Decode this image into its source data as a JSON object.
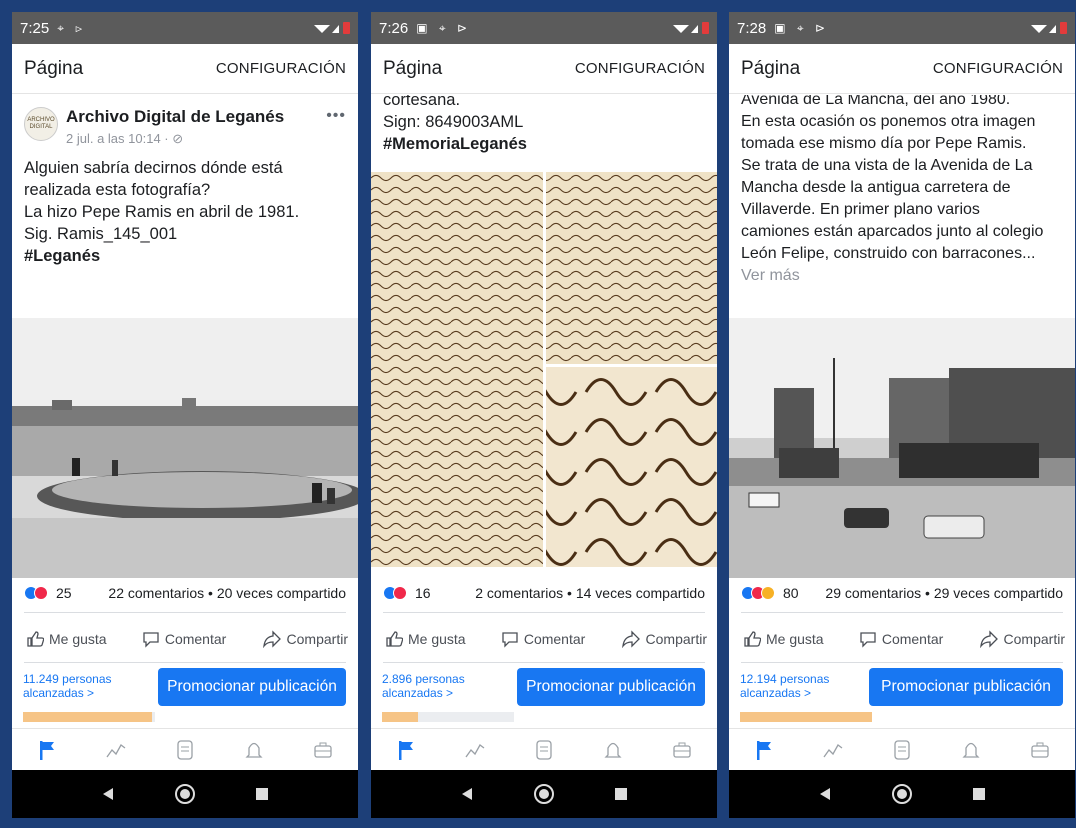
{
  "screens": [
    {
      "time": "7:25",
      "status_icons": "⌖ ⊳",
      "header": {
        "title": "Página",
        "config": "CONFIGURACIÓN"
      },
      "post": {
        "page_name": "Archivo Digital de Leganés",
        "meta": "2 jul. a las 10:14 · ",
        "avatar_text": "ARCHIVO DIGITAL",
        "lines": [
          "Alguien sabría decirnos dónde está",
          "realizada esta fotografía?",
          "La hizo Pepe Ramis en abril de 1981.",
          "Sig. Ramis_145_001"
        ],
        "hashtag": "#Leganés"
      },
      "reactions_count": "25",
      "comments_shares": "22 comentarios • 20 veces compartido",
      "actions": {
        "like": "Me gusta",
        "comment": "Comentar",
        "share": "Compartir"
      },
      "reach_line1": "11.249 personas",
      "reach_line2": "alcanzadas >",
      "reach_progress": 0.98,
      "promote": "Promocionar publicación"
    },
    {
      "time": "7:26",
      "status_icons": "▣ ⌖ ⊳",
      "header": {
        "title": "Página",
        "config": "CONFIGURACIÓN"
      },
      "post": {
        "lines": [
          "cortesana.",
          "Sign: 8649003AML"
        ],
        "hashtag": "#MemoriaLeganés"
      },
      "reactions_count": "16",
      "comments_shares": "2 comentarios • 14 veces compartido",
      "actions": {
        "like": "Me gusta",
        "comment": "Comentar",
        "share": "Compartir"
      },
      "reach_line1": "2.896 personas",
      "reach_line2": "alcanzadas >",
      "reach_progress": 0.27,
      "promote": "Promocionar publicación"
    },
    {
      "time": "7:28",
      "status_icons": "▣ ⌖ ⊳",
      "header": {
        "title": "Página",
        "config": "CONFIGURACIÓN"
      },
      "post": {
        "lines": [
          "Avenida de La Mancha, del año 1980.",
          "En esta ocasión os ponemos otra imagen",
          "tomada ese mismo día por Pepe Ramis.",
          "Se trata de una vista de la Avenida de La",
          "Mancha desde la antigua carretera de",
          "Villaverde. En primer plano  varios",
          "camiones están aparcados junto al colegio",
          "León Felipe, construido con barracones..."
        ],
        "see_more": "Ver más"
      },
      "reactions_count": "80",
      "comments_shares": "29 comentarios • 29 veces compartido",
      "actions": {
        "like": "Me gusta",
        "comment": "Comentar",
        "share": "Compartir"
      },
      "reach_line1": "12.194 personas",
      "reach_line2": "alcanzadas >",
      "reach_progress": 1.0,
      "promote": "Promocionar publicación"
    }
  ]
}
